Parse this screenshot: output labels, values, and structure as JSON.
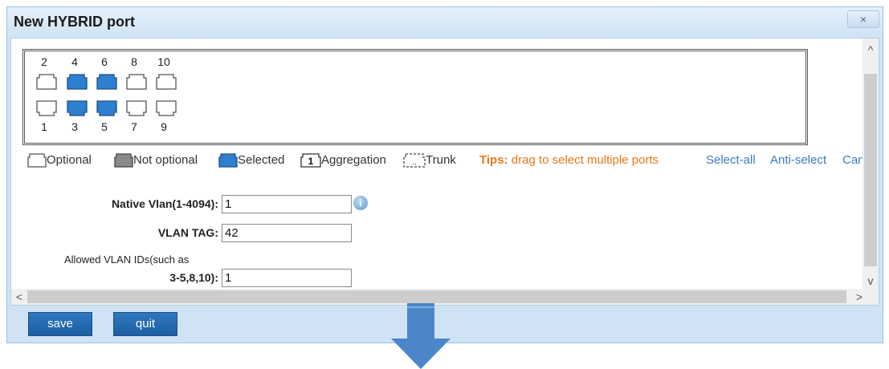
{
  "window": {
    "title": "New HYBRID port",
    "close_glyph": "×"
  },
  "ports": {
    "top": [
      {
        "num": "2",
        "state": "optional"
      },
      {
        "num": "4",
        "state": "selected"
      },
      {
        "num": "6",
        "state": "selected"
      },
      {
        "num": "8",
        "state": "optional"
      },
      {
        "num": "10",
        "state": "optional"
      }
    ],
    "bottom": [
      {
        "num": "1",
        "state": "optional"
      },
      {
        "num": "3",
        "state": "selected"
      },
      {
        "num": "5",
        "state": "selected"
      },
      {
        "num": "7",
        "state": "optional"
      },
      {
        "num": "9",
        "state": "optional"
      }
    ]
  },
  "legend": {
    "optional": "Optional",
    "not_optional": "Not optional",
    "selected": "Selected",
    "aggregation_num": "1",
    "aggregation": "Aggregation",
    "trunk": "Trunk",
    "tips_label": "Tips:",
    "tips_text": "drag to select multiple ports",
    "select_all": "Select-all",
    "anti_select": "Anti-select",
    "cancel": "Cance"
  },
  "form": {
    "native_vlan_label": "Native Vlan(1-4094):",
    "native_vlan_value": "1",
    "vlan_tag_label": "VLAN TAG:",
    "vlan_tag_value": "42",
    "allowed_label_line1": "Allowed VLAN IDs(such as",
    "allowed_label_line2": "3-5,8,10):",
    "allowed_value": "1",
    "info_glyph": "i"
  },
  "scroll": {
    "up": "^",
    "down": "v",
    "left": "<",
    "right": ">"
  },
  "buttons": {
    "save": "save",
    "quit": "quit"
  },
  "colors": {
    "port_optional": "#ffffff",
    "port_selected": "#2f7fd0",
    "port_not_optional": "#888888",
    "tips": "#e8771b",
    "link": "#3b7cc0",
    "button": "#2a6fb5",
    "arrow": "#4a86c8"
  }
}
